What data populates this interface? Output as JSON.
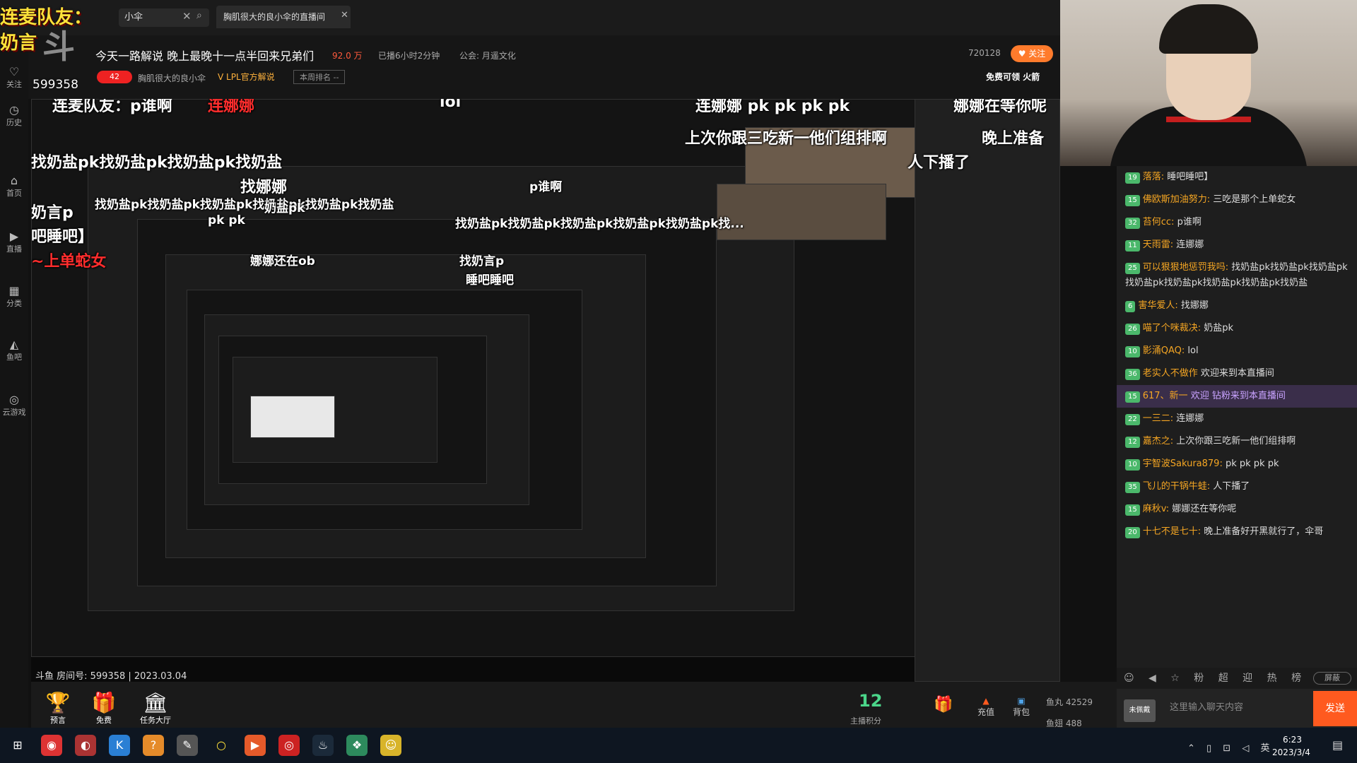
{
  "topbar": {
    "search_value": "小伞",
    "tab_title": "胸肌很大的良小伞的直播间"
  },
  "overlay": {
    "lianmai": "连麦队友：",
    "naiyan": "奶言",
    "room_id": "599358"
  },
  "room": {
    "title": "今天一路解说 晚上最晚十一点半回来兄弟们",
    "hot": "92.0 万",
    "live_for": "已播6小时2分钟",
    "guild": "公会: 月遥文化",
    "streamer": "胸肌很大的良小伞",
    "lpl_badge": "LPL官方解说",
    "weekly_rank": "本周排名 --",
    "followers": "720128",
    "follow_label": "关注",
    "free_gift": "免费可领 火箭",
    "level": "42"
  },
  "left_nav": [
    {
      "icon": "关注",
      "label": "关注"
    },
    {
      "icon": "◷",
      "label": "历史"
    },
    {
      "icon": "⌂",
      "label": "首页"
    },
    {
      "icon": "▶",
      "label": "直播"
    },
    {
      "icon": "▦",
      "label": "分类"
    },
    {
      "icon": "◭",
      "label": "鱼吧"
    },
    {
      "icon": "◎",
      "label": "云游戏"
    }
  ],
  "danmu": {
    "d1": "连麦队友：p谁啊",
    "d2": "连娜娜",
    "d3": "lol",
    "d4": "连娜娜  pk pk pk pk",
    "d5": "娜娜在等你呢",
    "d6": "上次你跟三吃新一他们组排啊",
    "d7": "晚上准备",
    "d8": "人下播了",
    "d9": "找奶盐pk找奶盐pk找奶盐pk找奶盐",
    "d10": "找娜娜",
    "d11": "奶言p",
    "d12": "吧睡吧】",
    "d13": "~上单蛇女",
    "d14": "pk pk",
    "d15": "找奶盐pk找奶盐pk找奶盐pk找奶盐pk找奶盐pk找奶盐",
    "d16": "找奶盐pk找奶盐pk找奶盐pk找奶盐pk找奶盐pk找...",
    "d17": "娜娜还在ob",
    "d18": "找奶言p",
    "d19": "睡吧睡吧",
    "d20": "p谁啊",
    "d21": "奶盐pk"
  },
  "chat": {
    "messages": [
      {
        "lvl": "19",
        "user": "落落:",
        "text": "睡吧睡吧】"
      },
      {
        "lvl": "15",
        "user": "佛欧斯加油努力:",
        "text": "三吃是那个上单蛇女"
      },
      {
        "lvl": "32",
        "user": "苔何cc:",
        "text": "p谁啊"
      },
      {
        "lvl": "11",
        "user": "天雨雷:",
        "text": "连娜娜"
      },
      {
        "lvl": "25",
        "user": "可以狠狠地惩罚我吗:",
        "text": "找奶盐pk找奶盐pk找奶盐pk找奶盐pk找奶盐pk找奶盐pk找奶盐pk找奶盐"
      },
      {
        "lvl": "6",
        "user": "害华爱人:",
        "text": "找娜娜"
      },
      {
        "lvl": "26",
        "user": "喵了个咪裁决:",
        "text": "奶盐pk"
      },
      {
        "lvl": "10",
        "user": "影涌QAQ:",
        "text": "lol"
      },
      {
        "lvl": "36",
        "user": "老实人不做作",
        "text": "欢迎来到本直播间"
      },
      {
        "lvl": "15",
        "user": "617、新一",
        "text": "欢迎 钻粉来到本直播间",
        "highlight": true
      },
      {
        "lvl": "22",
        "user": "一三二:",
        "text": "连娜娜"
      },
      {
        "lvl": "12",
        "user": "嘉杰之:",
        "text": "上次你跟三吃新一他们组排啊"
      },
      {
        "lvl": "10",
        "user": "宇智波Sakura879:",
        "text": "pk pk pk pk"
      },
      {
        "lvl": "35",
        "user": "飞儿的干锅牛蛙:",
        "text": "人下播了"
      },
      {
        "lvl": "15",
        "user": "麻秋v:",
        "text": "娜娜还在等你呢"
      },
      {
        "lvl": "20",
        "user": "十七不是七十:",
        "text": "晚上准备好开黑就行了，伞哥"
      }
    ],
    "tools": "☺ ◀ ☆ 粉 超 迎 热 榜",
    "shield_label": "屏蔽",
    "input_placeholder": "这里输入聊天内容",
    "send_label": "发送",
    "unranked_label": "未佩戴"
  },
  "bottom": {
    "room_no": "斗鱼 房间号: 599358 | 2023.03.04",
    "gifts": [
      {
        "icon": "🏆",
        "label": "预言"
      },
      {
        "icon": "🎁",
        "label": "免费"
      },
      {
        "icon": "🏛",
        "label": "任务大厅"
      }
    ],
    "points": "12",
    "points_label": "主播积分",
    "gift_icon": "🎁",
    "recharge": "充值",
    "backpack": "背包",
    "fish_ball": "鱼丸  42529",
    "fish_wing": "鱼翅  488"
  },
  "taskbar": {
    "apps": [
      "⊞",
      "◉",
      "◐",
      "K",
      "?",
      "✎",
      "○",
      "▶",
      "◎",
      "♨",
      "❖",
      "☺"
    ],
    "tray": "⌃ ▯ ⊡ ◁ 英",
    "time": "6:23",
    "date": "2023/3/4"
  },
  "colors": {
    "accent": "#ff5a1f",
    "danmu_red": "#ff2d2d",
    "overlay_yellow": "#ffe23a",
    "points_green": "#4bd68a"
  }
}
